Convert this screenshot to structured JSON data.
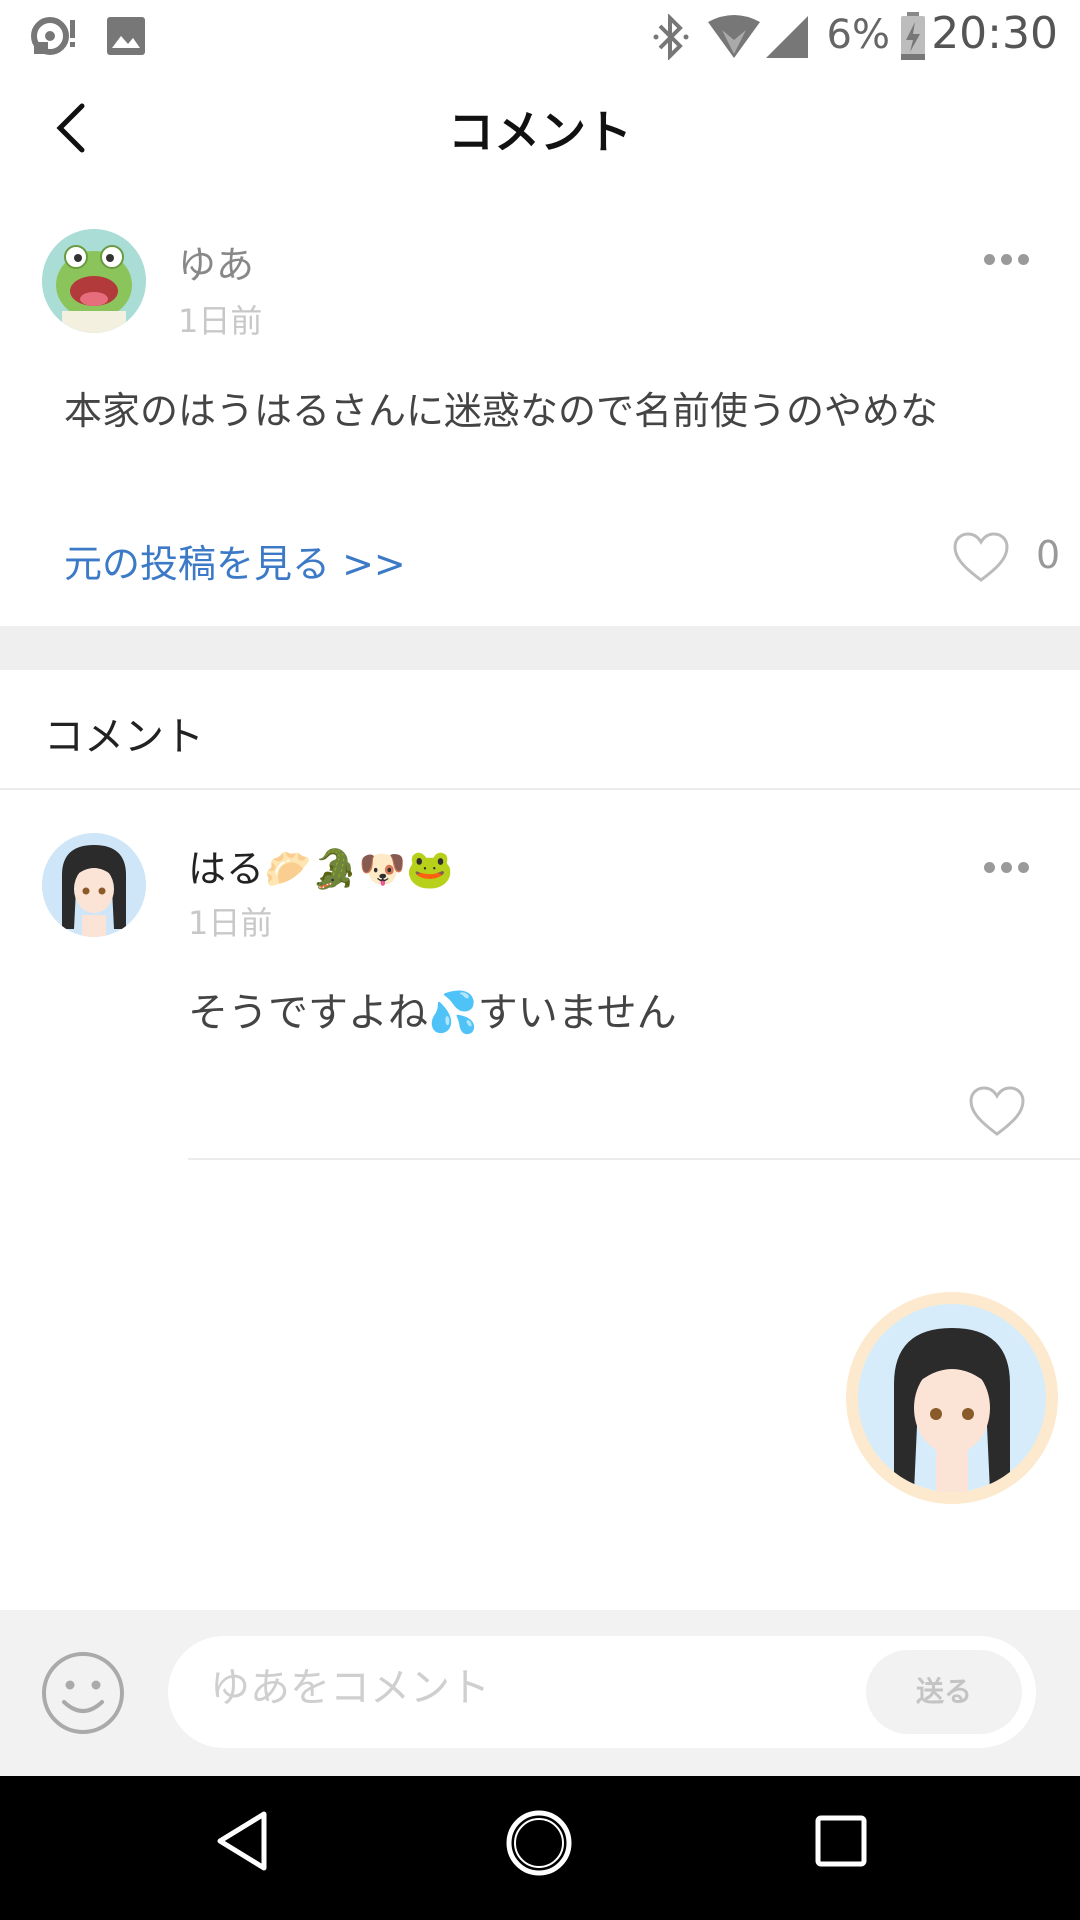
{
  "status_bar": {
    "battery_percent": "6%",
    "time": "20:30",
    "icons": [
      "podcast-icon",
      "image-icon",
      "bluetooth-icon",
      "wifi-icon",
      "signal-icon",
      "battery-charging-icon"
    ]
  },
  "header": {
    "title": "コメント",
    "back_icon": "chevron-left-icon"
  },
  "post": {
    "username": "ゆあ",
    "time": "1日前",
    "text": "本家のはうはるさんに迷惑なので名前使うのやめな",
    "view_original_link": "元の投稿を見る >>",
    "like_count": "0"
  },
  "comments_section": {
    "label": "コメント",
    "items": [
      {
        "username": "はる🥟🐊🐶🐸",
        "time": "1日前",
        "text": "そうですよね💦すいません"
      }
    ]
  },
  "input_bar": {
    "placeholder": "ゆあをコメント",
    "send_label": "送る"
  },
  "colors": {
    "link": "#3c7ac8",
    "band": "#efefef",
    "input_bar_bg": "#f2f2f2"
  }
}
